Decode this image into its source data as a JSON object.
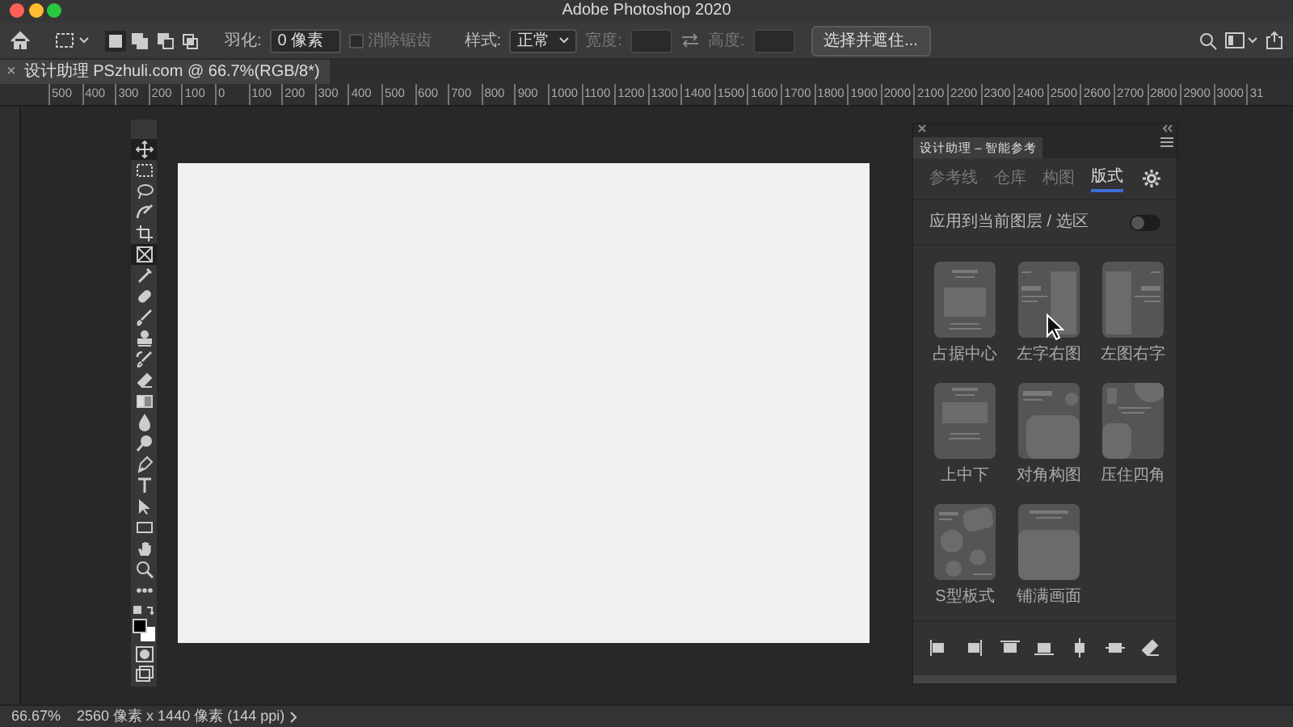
{
  "window": {
    "title": "Adobe Photoshop 2020"
  },
  "options_bar": {
    "modes": [
      {
        "kind": "new",
        "selected": true
      },
      {
        "kind": "add",
        "selected": false
      },
      {
        "kind": "subtract",
        "selected": false
      },
      {
        "kind": "intersect",
        "selected": false
      }
    ],
    "feather_label": "羽化:",
    "feather_value": "0 像素",
    "antialias": {
      "label": "消除锯齿",
      "checked": false,
      "disabled": true
    },
    "style_label": "样式:",
    "style_value": "正常",
    "width_label": "宽度:",
    "height_label": "高度:",
    "select_mask_button": "选择并遮住..."
  },
  "document_tab": {
    "close": "×",
    "title": "设计助理 PSzhuli.com @ 66.7%(RGB/8*)"
  },
  "ruler": [
    "500",
    "400",
    "300",
    "200",
    "100",
    "0",
    "100",
    "200",
    "300",
    "400",
    "500",
    "600",
    "700",
    "800",
    "900",
    "1000",
    "1100",
    "1200",
    "1300",
    "1400",
    "1500",
    "1600",
    "1700",
    "1800",
    "1900",
    "2000",
    "2100",
    "2200",
    "2300",
    "2400",
    "2500",
    "2600",
    "2700",
    "2800",
    "2900",
    "3000",
    "31"
  ],
  "tools": [
    {
      "kind": "move",
      "selected": true
    },
    {
      "kind": "marquee",
      "selected": false
    },
    {
      "kind": "lasso",
      "selected": false
    },
    {
      "kind": "quick-select",
      "selected": false
    },
    {
      "kind": "crop",
      "selected": false
    },
    {
      "kind": "frame",
      "selected": true
    },
    {
      "kind": "eyedropper",
      "selected": false
    },
    {
      "kind": "healing",
      "selected": false
    },
    {
      "kind": "brush",
      "selected": false
    },
    {
      "kind": "stamp",
      "selected": false
    },
    {
      "kind": "history-brush",
      "selected": false
    },
    {
      "kind": "eraser",
      "selected": false
    },
    {
      "kind": "gradient",
      "selected": false
    },
    {
      "kind": "blur",
      "selected": false
    },
    {
      "kind": "dodge",
      "selected": false
    },
    {
      "kind": "pen",
      "selected": false
    },
    {
      "kind": "type",
      "selected": false
    },
    {
      "kind": "path-select",
      "selected": false
    },
    {
      "kind": "rectangle",
      "selected": false
    },
    {
      "kind": "hand",
      "selected": false
    },
    {
      "kind": "zoom",
      "selected": false
    },
    {
      "kind": "more",
      "selected": false
    }
  ],
  "panel": {
    "title": "设计助理 – 智能参考",
    "tabs": [
      {
        "label": "参考线",
        "selected": false
      },
      {
        "label": "仓库",
        "selected": false
      },
      {
        "label": "构图",
        "selected": false
      },
      {
        "label": "版式",
        "selected": true
      }
    ],
    "apply_toggle": {
      "label": "应用到当前图层 / 选区",
      "on": false
    },
    "layouts": [
      {
        "label": "占据中心",
        "kind": "center"
      },
      {
        "label": "左字右图",
        "kind": "text-left"
      },
      {
        "label": "左图右字",
        "kind": "image-left"
      },
      {
        "label": "上中下",
        "kind": "stacked"
      },
      {
        "label": "对角构图",
        "kind": "diagonal"
      },
      {
        "label": "压住四角",
        "kind": "corners"
      },
      {
        "label": "S型板式",
        "kind": "s-shape"
      },
      {
        "label": "铺满画面",
        "kind": "full"
      }
    ],
    "align_tools": [
      {
        "kind": "align-left"
      },
      {
        "kind": "align-right"
      },
      {
        "kind": "align-top"
      },
      {
        "kind": "align-bottom"
      },
      {
        "kind": "align-hcenter"
      },
      {
        "kind": "align-vcenter"
      },
      {
        "kind": "eraser"
      }
    ]
  },
  "status_bar": {
    "zoom": "66.67%",
    "info": "2560 像素 x 1440 像素 (144 ppi)"
  }
}
